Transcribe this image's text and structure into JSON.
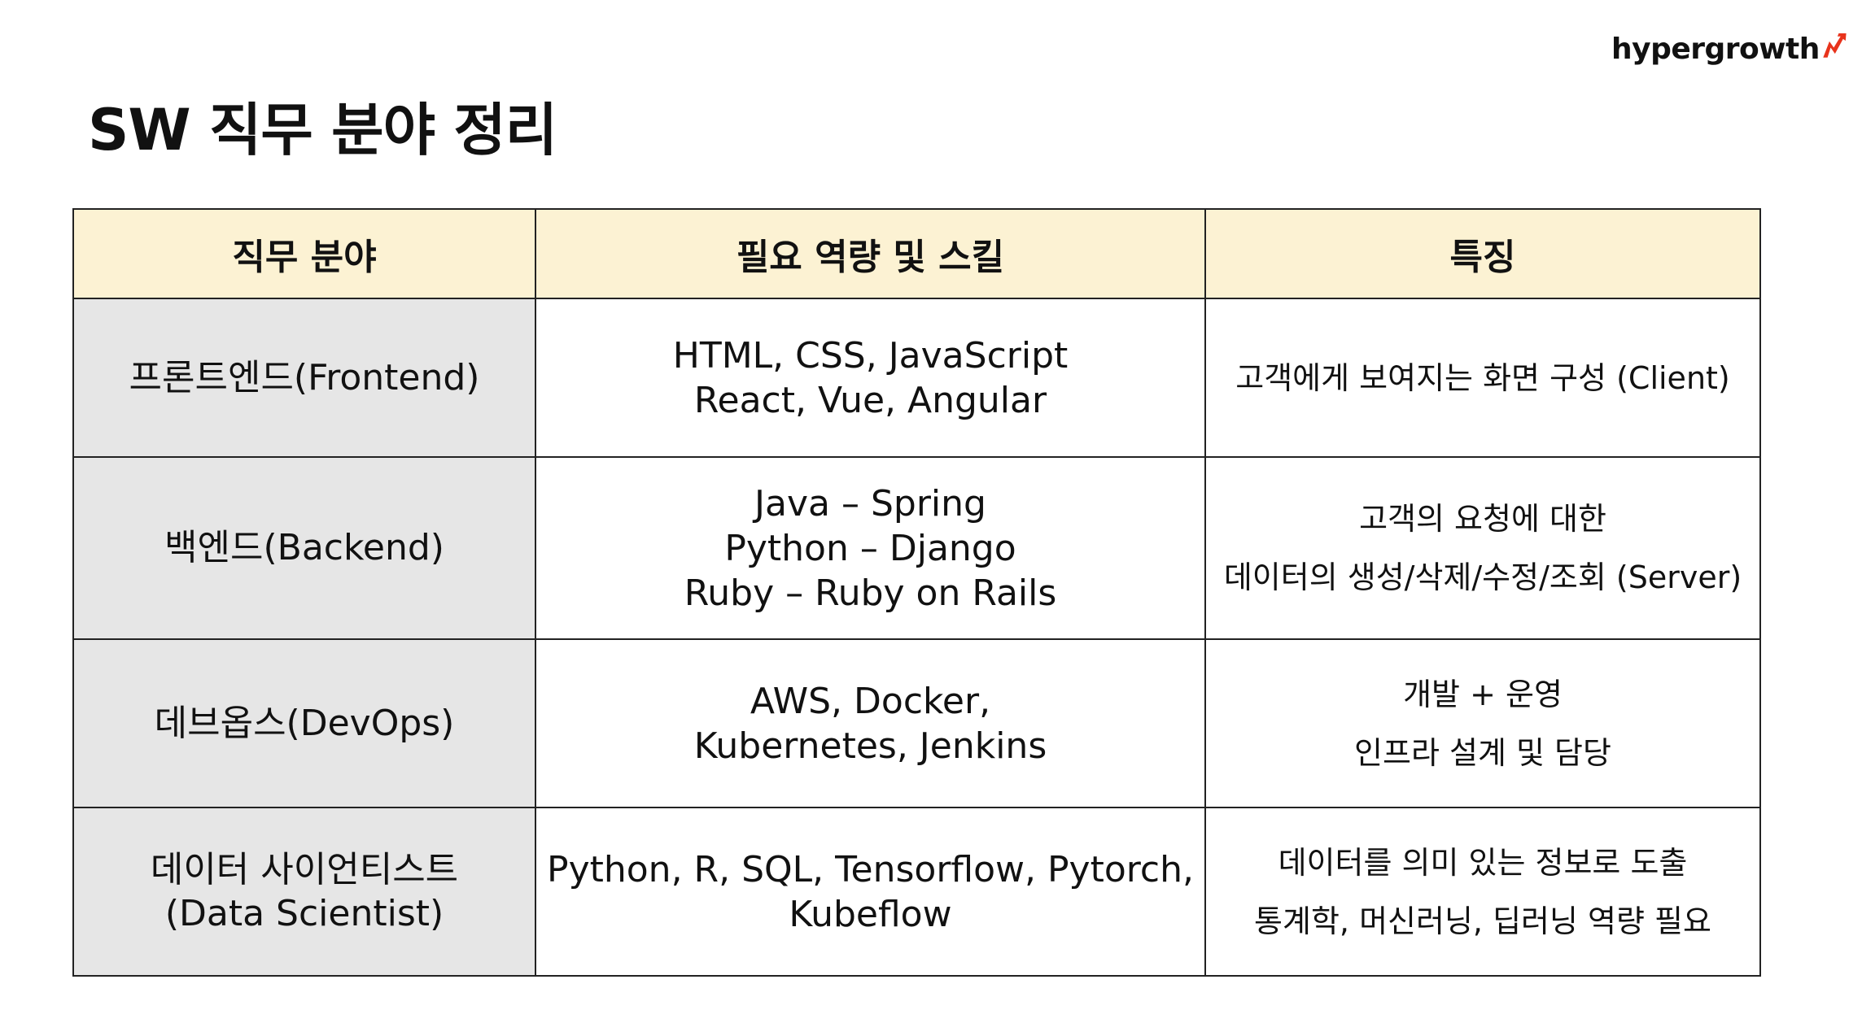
{
  "brand": {
    "name": "hypergrowth",
    "accent_color": "#e8331c"
  },
  "slide": {
    "title": "SW 직무 분야 정리"
  },
  "table": {
    "headers": [
      "직무 분야",
      "필요 역량 및 스킬",
      "특징"
    ],
    "header_bg": "#fcf2d3",
    "role_bg": "#e6e6e6",
    "rows": [
      {
        "role": [
          "프론트엔드(Frontend)"
        ],
        "skills": [
          "HTML, CSS, JavaScript",
          "React, Vue, Angular"
        ],
        "notes": [
          "고객에게 보여지는 화면 구성 (Client)"
        ]
      },
      {
        "role": [
          "백엔드(Backend)"
        ],
        "skills": [
          "Java – Spring",
          "Python – Django",
          "Ruby – Ruby on Rails"
        ],
        "notes": [
          "고객의 요청에 대한",
          "데이터의 생성/삭제/수정/조회 (Server)"
        ]
      },
      {
        "role": [
          "데브옵스(DevOps)"
        ],
        "skills": [
          "AWS, Docker,",
          "Kubernetes, Jenkins"
        ],
        "notes": [
          "개발 + 운영",
          "인프라 설계 및 담당"
        ]
      },
      {
        "role": [
          "데이터 사이언티스트",
          "(Data Scientist)"
        ],
        "skills": [
          "Python, R, SQL, Tensorflow, Pytorch,",
          "Kubeflow"
        ],
        "notes": [
          "데이터를 의미 있는 정보로 도출",
          "통계학, 머신러닝, 딥러닝 역량 필요"
        ]
      }
    ]
  }
}
